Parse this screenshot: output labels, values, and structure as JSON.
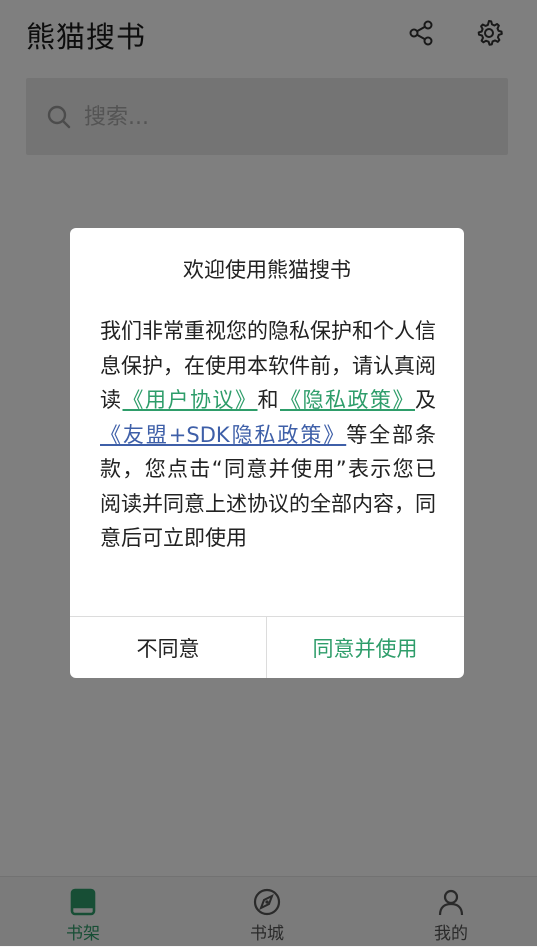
{
  "app": {
    "title": "熊猫搜书",
    "share_icon": "share-icon",
    "settings_icon": "gear-icon"
  },
  "search": {
    "placeholder": "搜索..."
  },
  "bottom_nav": [
    {
      "label": "书架",
      "icon": "bookshelf-icon",
      "active": true
    },
    {
      "label": "书城",
      "icon": "compass-icon",
      "active": false
    },
    {
      "label": "我的",
      "icon": "user-icon",
      "active": false
    }
  ],
  "dialog": {
    "title": "欢迎使用熊猫搜书",
    "text_1": "我们非常重视您的隐私保护和个人信息保护，在使用本软件前，请认真阅读",
    "link_user_agreement": "《用户协议》",
    "text_2": "和",
    "link_privacy_policy": "《隐私政策》",
    "text_3": "及",
    "link_umeng_sdk": "《友盟+SDK隐私政策》",
    "text_4": "等全部条款，您点击“同意并使用”表示您已阅读并同意上述协议的全部内容，同意后可立即使用",
    "decline_label": "不同意",
    "agree_label": "同意并使用"
  },
  "colors": {
    "accent": "#2e9d6a",
    "link_blue": "#3e5fa8",
    "overlay": "rgba(0,0,0,0.5)"
  }
}
